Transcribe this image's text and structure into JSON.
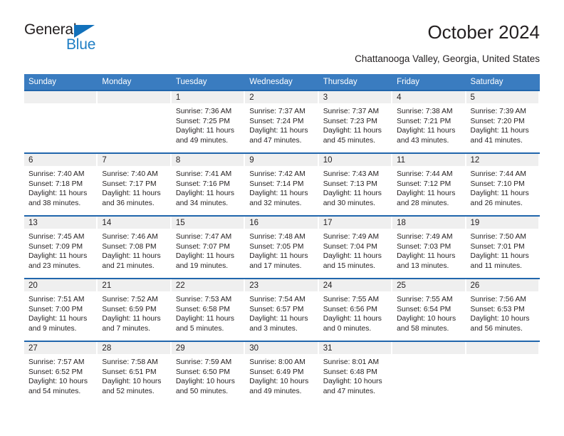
{
  "brand": {
    "name_part1": "General",
    "name_part2": "Blue"
  },
  "header": {
    "title": "October 2024",
    "subtitle": "Chattanooga Valley, Georgia, United States"
  },
  "colors": {
    "header_blue": "#3a7cc0",
    "row_rule_blue": "#2166ac",
    "daynum_band": "#efefef",
    "logo_blue": "#1f7ec4",
    "text": "#231f20"
  },
  "weekday_headers": [
    "Sunday",
    "Monday",
    "Tuesday",
    "Wednesday",
    "Thursday",
    "Friday",
    "Saturday"
  ],
  "weeks": [
    [
      {
        "day": "",
        "sunrise": "",
        "sunset": "",
        "daylight_line1": "",
        "daylight_line2": ""
      },
      {
        "day": "",
        "sunrise": "",
        "sunset": "",
        "daylight_line1": "",
        "daylight_line2": ""
      },
      {
        "day": "1",
        "sunrise": "Sunrise: 7:36 AM",
        "sunset": "Sunset: 7:25 PM",
        "daylight_line1": "Daylight: 11 hours",
        "daylight_line2": "and 49 minutes."
      },
      {
        "day": "2",
        "sunrise": "Sunrise: 7:37 AM",
        "sunset": "Sunset: 7:24 PM",
        "daylight_line1": "Daylight: 11 hours",
        "daylight_line2": "and 47 minutes."
      },
      {
        "day": "3",
        "sunrise": "Sunrise: 7:37 AM",
        "sunset": "Sunset: 7:23 PM",
        "daylight_line1": "Daylight: 11 hours",
        "daylight_line2": "and 45 minutes."
      },
      {
        "day": "4",
        "sunrise": "Sunrise: 7:38 AM",
        "sunset": "Sunset: 7:21 PM",
        "daylight_line1": "Daylight: 11 hours",
        "daylight_line2": "and 43 minutes."
      },
      {
        "day": "5",
        "sunrise": "Sunrise: 7:39 AM",
        "sunset": "Sunset: 7:20 PM",
        "daylight_line1": "Daylight: 11 hours",
        "daylight_line2": "and 41 minutes."
      }
    ],
    [
      {
        "day": "6",
        "sunrise": "Sunrise: 7:40 AM",
        "sunset": "Sunset: 7:18 PM",
        "daylight_line1": "Daylight: 11 hours",
        "daylight_line2": "and 38 minutes."
      },
      {
        "day": "7",
        "sunrise": "Sunrise: 7:40 AM",
        "sunset": "Sunset: 7:17 PM",
        "daylight_line1": "Daylight: 11 hours",
        "daylight_line2": "and 36 minutes."
      },
      {
        "day": "8",
        "sunrise": "Sunrise: 7:41 AM",
        "sunset": "Sunset: 7:16 PM",
        "daylight_line1": "Daylight: 11 hours",
        "daylight_line2": "and 34 minutes."
      },
      {
        "day": "9",
        "sunrise": "Sunrise: 7:42 AM",
        "sunset": "Sunset: 7:14 PM",
        "daylight_line1": "Daylight: 11 hours",
        "daylight_line2": "and 32 minutes."
      },
      {
        "day": "10",
        "sunrise": "Sunrise: 7:43 AM",
        "sunset": "Sunset: 7:13 PM",
        "daylight_line1": "Daylight: 11 hours",
        "daylight_line2": "and 30 minutes."
      },
      {
        "day": "11",
        "sunrise": "Sunrise: 7:44 AM",
        "sunset": "Sunset: 7:12 PM",
        "daylight_line1": "Daylight: 11 hours",
        "daylight_line2": "and 28 minutes."
      },
      {
        "day": "12",
        "sunrise": "Sunrise: 7:44 AM",
        "sunset": "Sunset: 7:10 PM",
        "daylight_line1": "Daylight: 11 hours",
        "daylight_line2": "and 26 minutes."
      }
    ],
    [
      {
        "day": "13",
        "sunrise": "Sunrise: 7:45 AM",
        "sunset": "Sunset: 7:09 PM",
        "daylight_line1": "Daylight: 11 hours",
        "daylight_line2": "and 23 minutes."
      },
      {
        "day": "14",
        "sunrise": "Sunrise: 7:46 AM",
        "sunset": "Sunset: 7:08 PM",
        "daylight_line1": "Daylight: 11 hours",
        "daylight_line2": "and 21 minutes."
      },
      {
        "day": "15",
        "sunrise": "Sunrise: 7:47 AM",
        "sunset": "Sunset: 7:07 PM",
        "daylight_line1": "Daylight: 11 hours",
        "daylight_line2": "and 19 minutes."
      },
      {
        "day": "16",
        "sunrise": "Sunrise: 7:48 AM",
        "sunset": "Sunset: 7:05 PM",
        "daylight_line1": "Daylight: 11 hours",
        "daylight_line2": "and 17 minutes."
      },
      {
        "day": "17",
        "sunrise": "Sunrise: 7:49 AM",
        "sunset": "Sunset: 7:04 PM",
        "daylight_line1": "Daylight: 11 hours",
        "daylight_line2": "and 15 minutes."
      },
      {
        "day": "18",
        "sunrise": "Sunrise: 7:49 AM",
        "sunset": "Sunset: 7:03 PM",
        "daylight_line1": "Daylight: 11 hours",
        "daylight_line2": "and 13 minutes."
      },
      {
        "day": "19",
        "sunrise": "Sunrise: 7:50 AM",
        "sunset": "Sunset: 7:01 PM",
        "daylight_line1": "Daylight: 11 hours",
        "daylight_line2": "and 11 minutes."
      }
    ],
    [
      {
        "day": "20",
        "sunrise": "Sunrise: 7:51 AM",
        "sunset": "Sunset: 7:00 PM",
        "daylight_line1": "Daylight: 11 hours",
        "daylight_line2": "and 9 minutes."
      },
      {
        "day": "21",
        "sunrise": "Sunrise: 7:52 AM",
        "sunset": "Sunset: 6:59 PM",
        "daylight_line1": "Daylight: 11 hours",
        "daylight_line2": "and 7 minutes."
      },
      {
        "day": "22",
        "sunrise": "Sunrise: 7:53 AM",
        "sunset": "Sunset: 6:58 PM",
        "daylight_line1": "Daylight: 11 hours",
        "daylight_line2": "and 5 minutes."
      },
      {
        "day": "23",
        "sunrise": "Sunrise: 7:54 AM",
        "sunset": "Sunset: 6:57 PM",
        "daylight_line1": "Daylight: 11 hours",
        "daylight_line2": "and 3 minutes."
      },
      {
        "day": "24",
        "sunrise": "Sunrise: 7:55 AM",
        "sunset": "Sunset: 6:56 PM",
        "daylight_line1": "Daylight: 11 hours",
        "daylight_line2": "and 0 minutes."
      },
      {
        "day": "25",
        "sunrise": "Sunrise: 7:55 AM",
        "sunset": "Sunset: 6:54 PM",
        "daylight_line1": "Daylight: 10 hours",
        "daylight_line2": "and 58 minutes."
      },
      {
        "day": "26",
        "sunrise": "Sunrise: 7:56 AM",
        "sunset": "Sunset: 6:53 PM",
        "daylight_line1": "Daylight: 10 hours",
        "daylight_line2": "and 56 minutes."
      }
    ],
    [
      {
        "day": "27",
        "sunrise": "Sunrise: 7:57 AM",
        "sunset": "Sunset: 6:52 PM",
        "daylight_line1": "Daylight: 10 hours",
        "daylight_line2": "and 54 minutes."
      },
      {
        "day": "28",
        "sunrise": "Sunrise: 7:58 AM",
        "sunset": "Sunset: 6:51 PM",
        "daylight_line1": "Daylight: 10 hours",
        "daylight_line2": "and 52 minutes."
      },
      {
        "day": "29",
        "sunrise": "Sunrise: 7:59 AM",
        "sunset": "Sunset: 6:50 PM",
        "daylight_line1": "Daylight: 10 hours",
        "daylight_line2": "and 50 minutes."
      },
      {
        "day": "30",
        "sunrise": "Sunrise: 8:00 AM",
        "sunset": "Sunset: 6:49 PM",
        "daylight_line1": "Daylight: 10 hours",
        "daylight_line2": "and 49 minutes."
      },
      {
        "day": "31",
        "sunrise": "Sunrise: 8:01 AM",
        "sunset": "Sunset: 6:48 PM",
        "daylight_line1": "Daylight: 10 hours",
        "daylight_line2": "and 47 minutes."
      },
      {
        "day": "",
        "sunrise": "",
        "sunset": "",
        "daylight_line1": "",
        "daylight_line2": ""
      },
      {
        "day": "",
        "sunrise": "",
        "sunset": "",
        "daylight_line1": "",
        "daylight_line2": ""
      }
    ]
  ]
}
